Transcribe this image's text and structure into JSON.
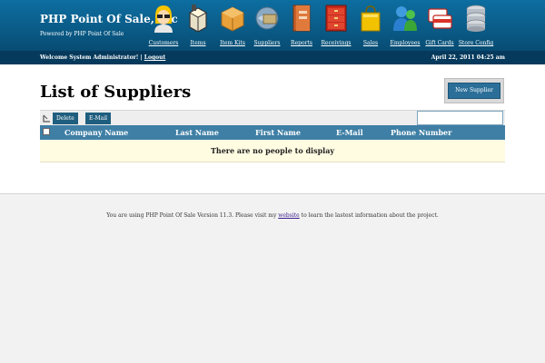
{
  "header": {
    "company": "PHP Point Of Sale, Inc",
    "powered_by": "Powered by PHP Point Of Sale",
    "nav": [
      {
        "label": "Customers",
        "icon": "customers-icon"
      },
      {
        "label": "Items",
        "icon": "items-icon"
      },
      {
        "label": "Item Kits",
        "icon": "item-kits-icon"
      },
      {
        "label": "Suppliers",
        "icon": "suppliers-icon"
      },
      {
        "label": "Reports",
        "icon": "reports-icon"
      },
      {
        "label": "Receivings",
        "icon": "receivings-icon"
      },
      {
        "label": "Sales",
        "icon": "sales-icon"
      },
      {
        "label": "Employees",
        "icon": "employees-icon"
      },
      {
        "label": "Gift Cards",
        "icon": "gift-cards-icon"
      },
      {
        "label": "Store Config",
        "icon": "store-config-icon"
      }
    ]
  },
  "welcome": {
    "text": "Welcome System Administrator! | ",
    "logout": "Logout",
    "datetime": "April 22, 2011 04:25 am"
  },
  "main": {
    "title": "List of Suppliers",
    "new_button": "New Supplier",
    "toolbar": {
      "delete": "Delete",
      "email": "E-Mail",
      "search_value": ""
    },
    "table": {
      "columns": [
        "Company Name",
        "Last Name",
        "First Name",
        "E-Mail",
        "Phone Number"
      ],
      "empty_message": "There are no people to display"
    }
  },
  "footer": {
    "before": "You are using PHP Point Of Sale Version 11.3. Please visit my ",
    "link": "website",
    "after": " to learn the lastest information about the project."
  },
  "colors": {
    "header": "#0a5c88",
    "bar": "#063a5c",
    "table_head": "#3f7fa5",
    "empty_row": "#fffce2"
  }
}
